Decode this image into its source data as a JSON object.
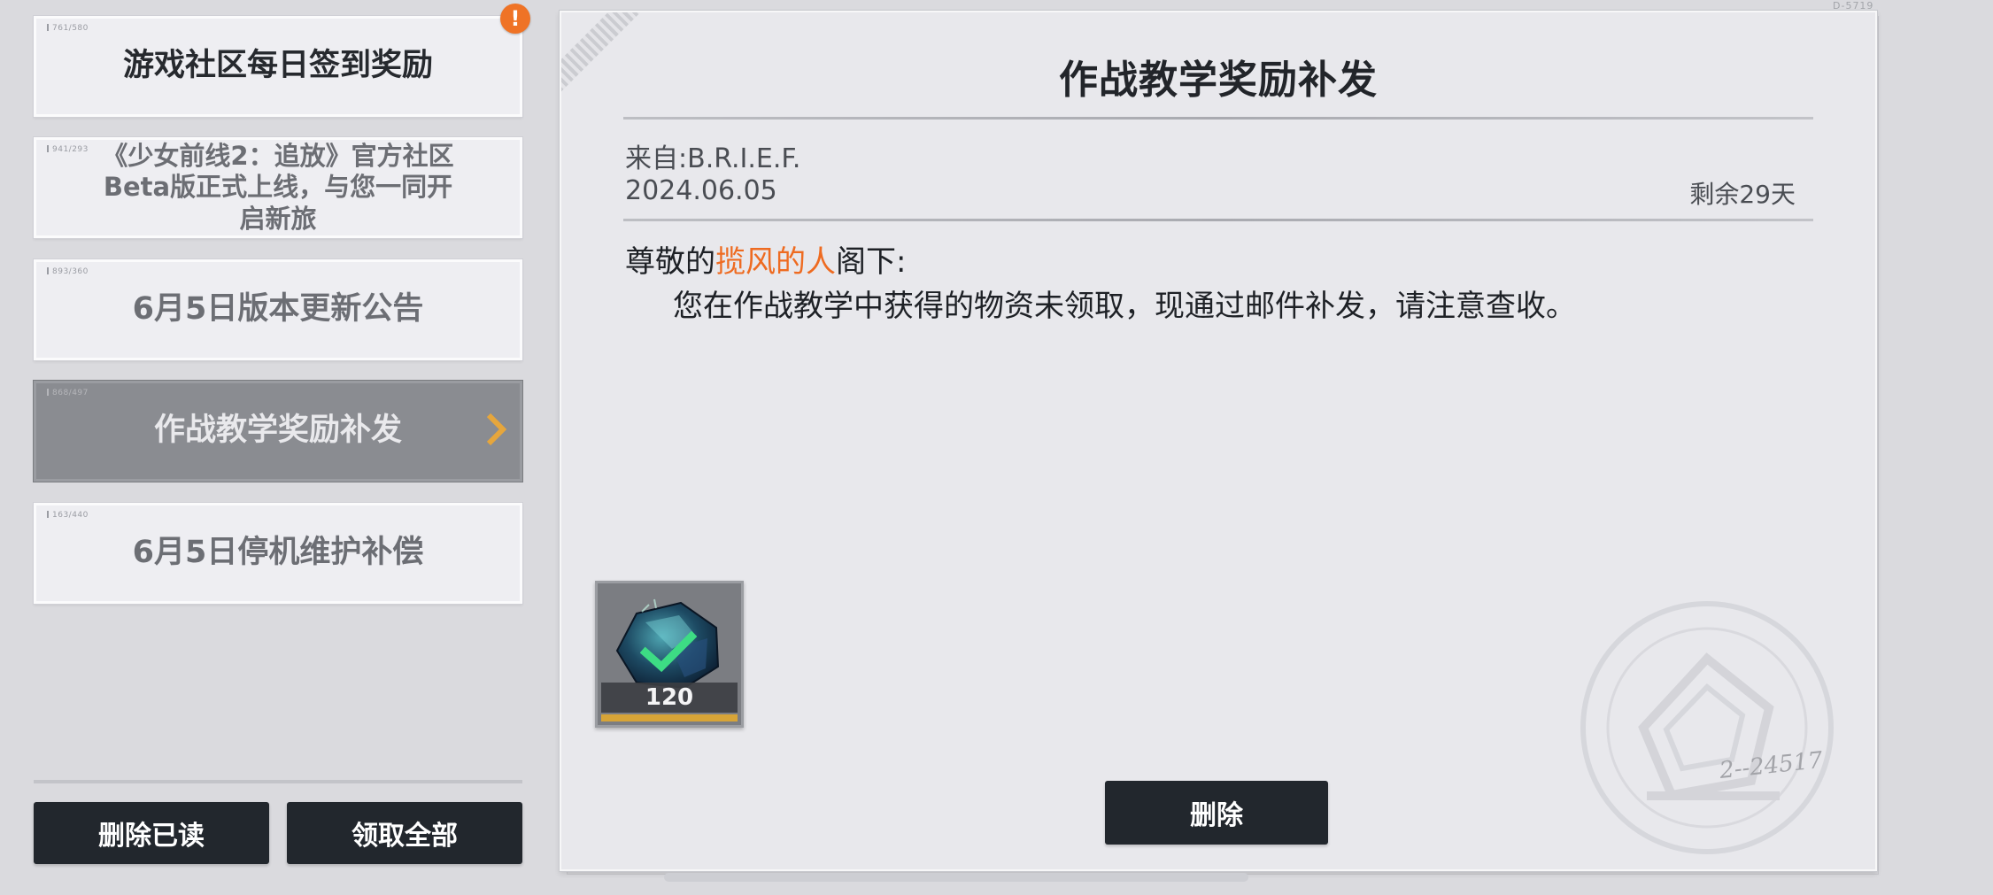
{
  "mail_list": {
    "items": [
      {
        "code": "761/580",
        "title": "游戏社区每日签到奖励",
        "unread": true,
        "selected": false
      },
      {
        "code": "941/293",
        "title": "《少女前线2：追放》官方社区Beta版正式上线，与您一同开启新旅",
        "unread": false,
        "selected": false
      },
      {
        "code": "893/360",
        "title": "6月5日版本更新公告",
        "unread": false,
        "selected": false
      },
      {
        "code": "868/497",
        "title": "作战教学奖励补发",
        "unread": false,
        "selected": true
      },
      {
        "code": "163/440",
        "title": "6月5日停机维护补偿",
        "unread": false,
        "selected": false
      }
    ],
    "alert_badge": "!",
    "delete_read_label": "删除已读",
    "claim_all_label": "领取全部"
  },
  "mail_detail": {
    "title": "作战教学奖励补发",
    "sender": "来自:B.R.I.E.F.",
    "date": "2024.06.05",
    "remaining": "剩余29天",
    "greeting_prefix": "尊敬的",
    "recipient_name": "揽风的人",
    "greeting_suffix": "阁下:",
    "body": "您在作战教学中获得的物资未领取，现通过邮件补发，请注意查收。",
    "reward": {
      "icon": "crystal-gem-icon",
      "quantity": "120",
      "claimed": true
    },
    "delete_label": "删除",
    "corner_code": "D-5719",
    "stamp_signature": "2--24517"
  },
  "colors": {
    "accent_orange": "#ee6b21",
    "dark_button": "#22272d",
    "selected_item": "#8a8c91",
    "claimed_check": "#3ddc84",
    "rarity_gold": "#d7a437"
  }
}
